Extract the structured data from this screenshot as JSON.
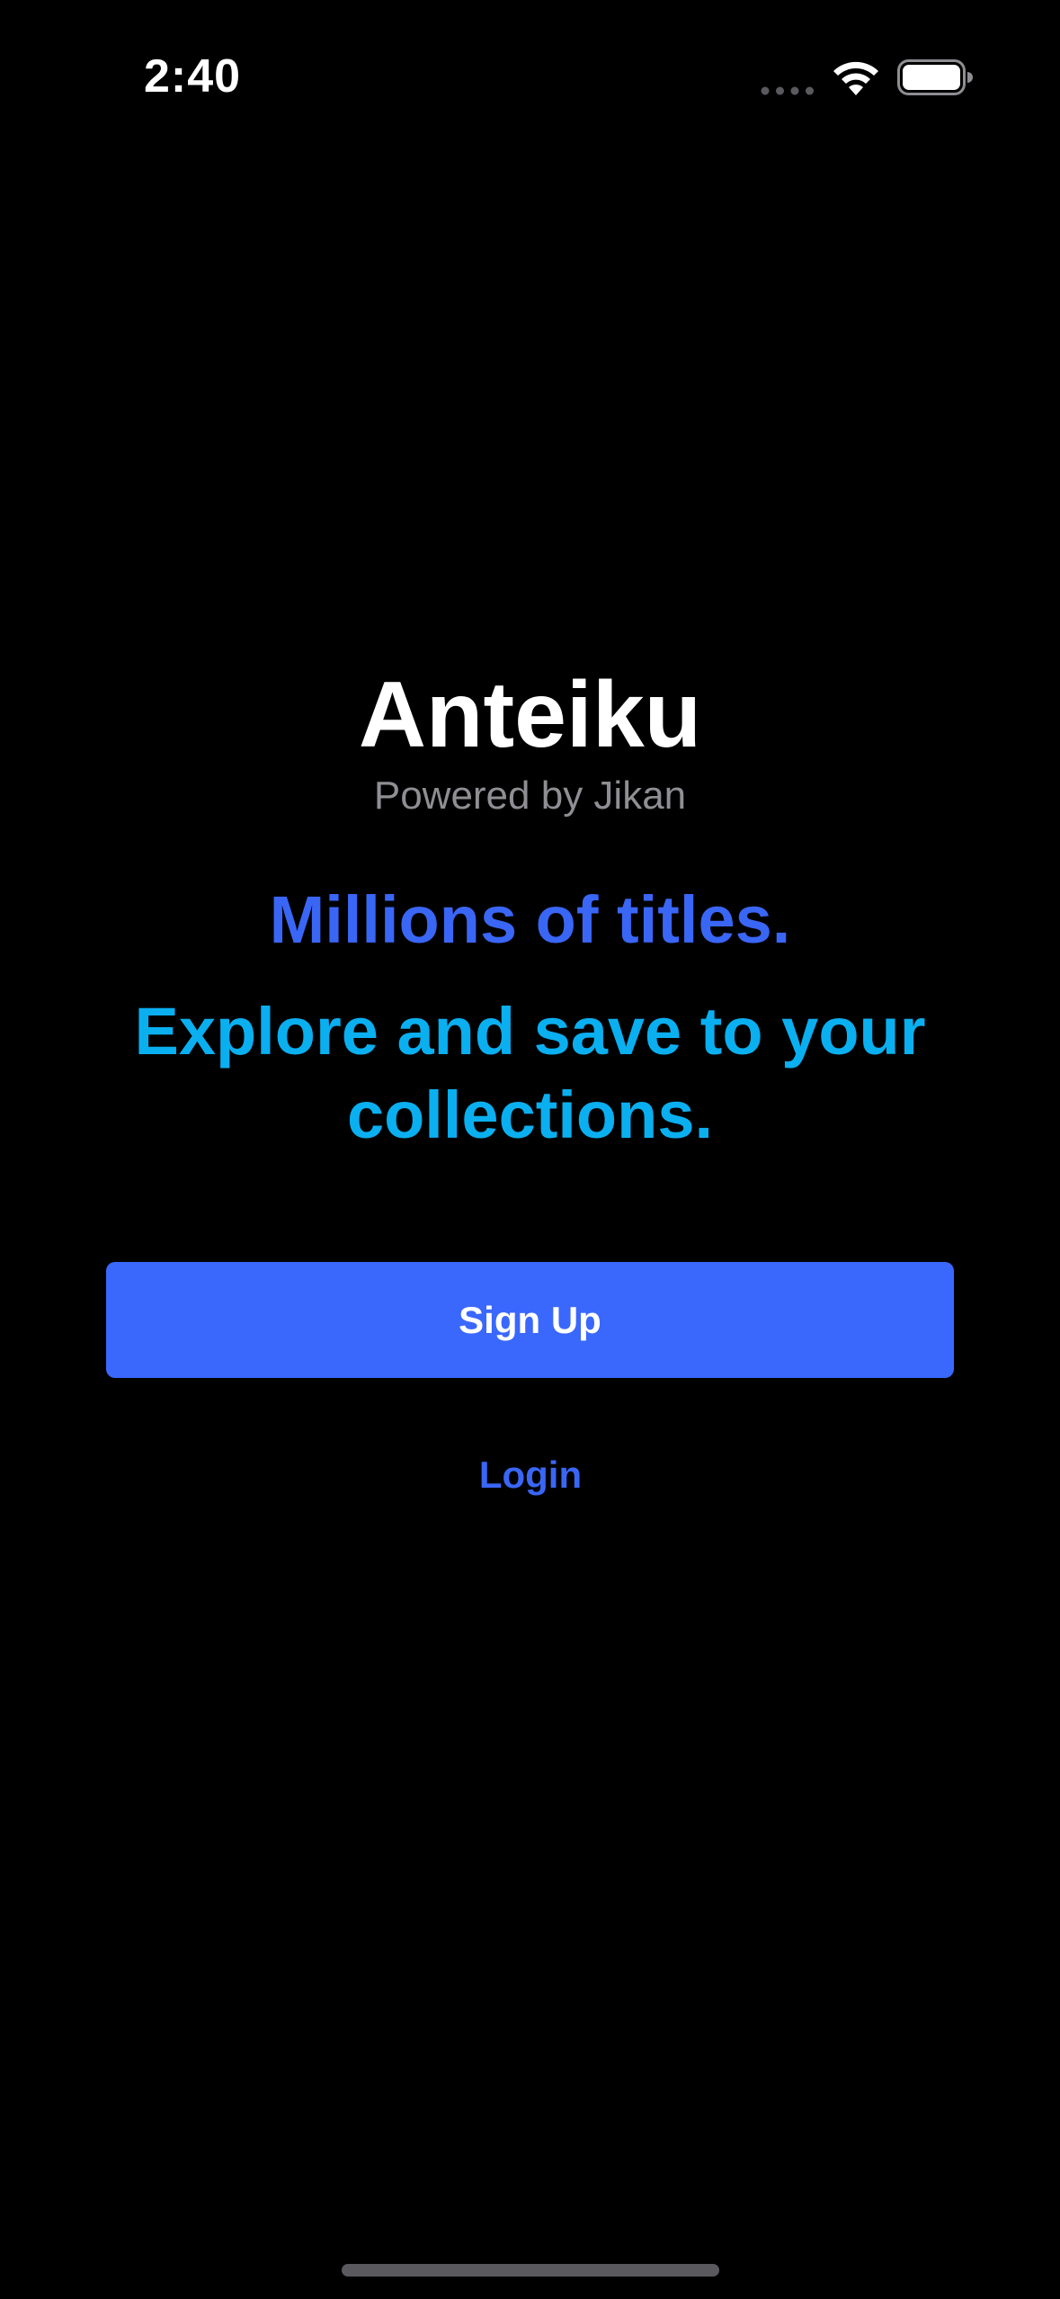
{
  "status_bar": {
    "time": "2:40",
    "icons": [
      "cellular-signal-icon",
      "wifi-icon",
      "battery-icon"
    ]
  },
  "app": {
    "title": "Anteiku",
    "subtitle": "Powered by Jikan"
  },
  "taglines": {
    "primary": "Millions of titles.",
    "secondary": "Explore and save to your collections."
  },
  "actions": {
    "signup_label": "Sign Up",
    "login_label": "Login"
  },
  "colors": {
    "background": "#000000",
    "primary_blue": "#3a66f6",
    "button_blue": "#3a68fd",
    "accent_cyan": "#0aaff0",
    "subtitle_gray": "#8e8e93"
  }
}
